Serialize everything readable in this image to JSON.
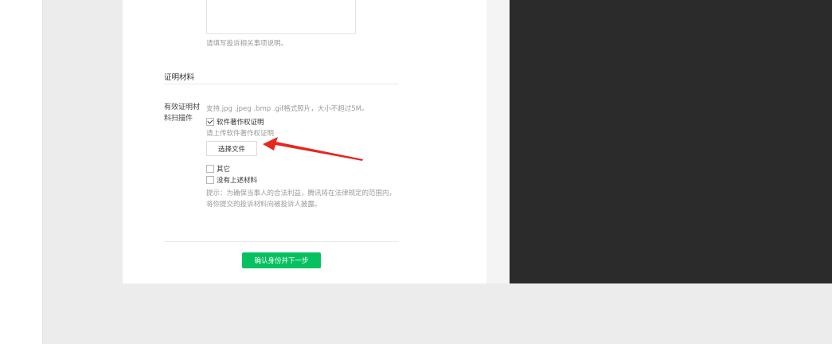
{
  "form": {
    "description_hint": "请填写投诉相关事项说明。",
    "section_title": "证明材料",
    "field_label": "有效证明材料扫描件",
    "format_hint": "支持.jpg .jpeg .bmp .gif格式照片，大小不超过5M。",
    "options": [
      {
        "label": "软件著作权证明",
        "checked": true
      },
      {
        "label": "其它",
        "checked": false
      },
      {
        "label": "没有上述材料",
        "checked": false
      }
    ],
    "upload_hint": "请上传软件著作权证明",
    "file_button_label": "选择文件",
    "privacy_notice": "提示：为确保当事人的合法利益，腾讯将在法律规定的范围内，将你提交的投诉材料向被投诉人披露。",
    "submit_label": "确认身份并下一步"
  },
  "colors": {
    "accent": "#07c160",
    "annotation_arrow": "#e8261e",
    "dark_panel": "#2b2b2b"
  }
}
